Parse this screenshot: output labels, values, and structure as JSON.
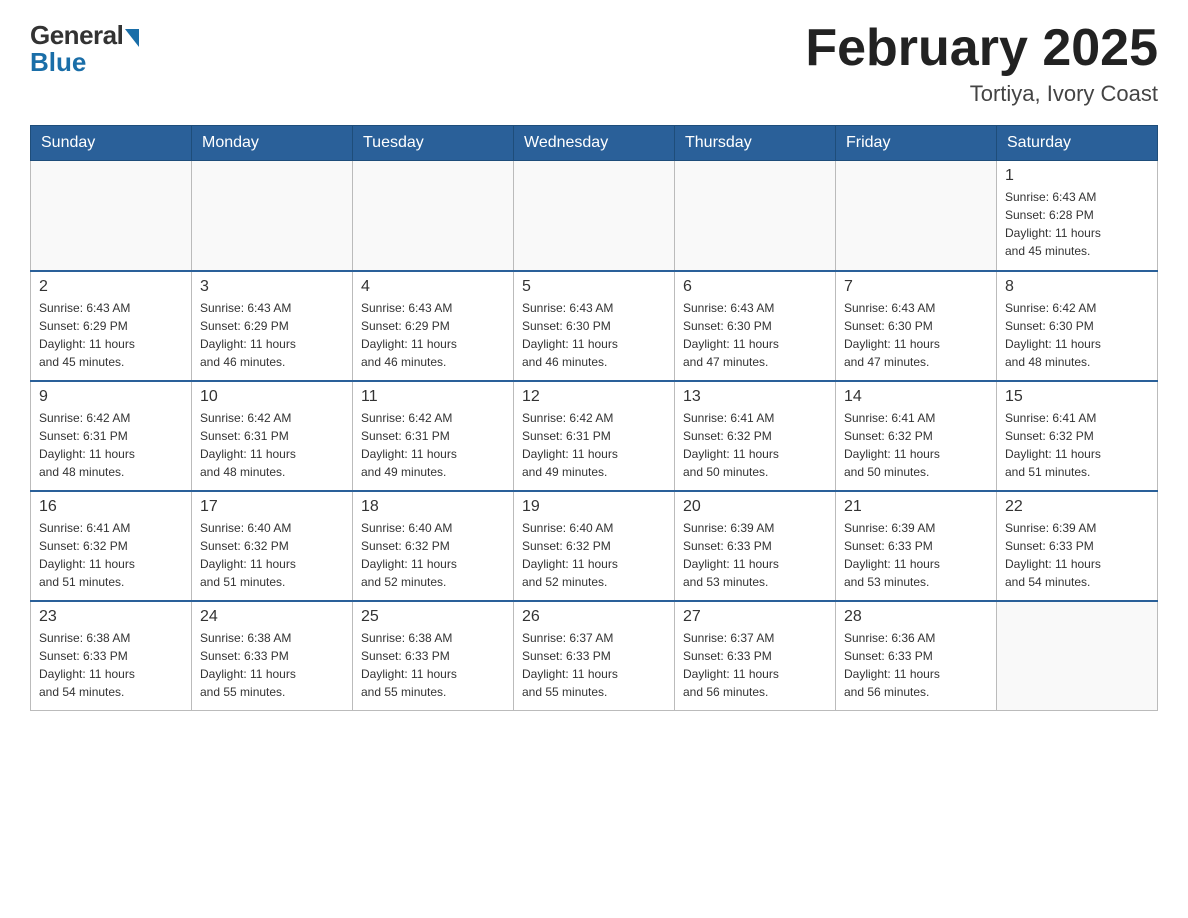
{
  "header": {
    "logo_general": "General",
    "logo_blue": "Blue",
    "month_title": "February 2025",
    "location": "Tortiya, Ivory Coast"
  },
  "weekdays": [
    "Sunday",
    "Monday",
    "Tuesday",
    "Wednesday",
    "Thursday",
    "Friday",
    "Saturday"
  ],
  "weeks": [
    [
      {
        "day": "",
        "info": ""
      },
      {
        "day": "",
        "info": ""
      },
      {
        "day": "",
        "info": ""
      },
      {
        "day": "",
        "info": ""
      },
      {
        "day": "",
        "info": ""
      },
      {
        "day": "",
        "info": ""
      },
      {
        "day": "1",
        "info": "Sunrise: 6:43 AM\nSunset: 6:28 PM\nDaylight: 11 hours\nand 45 minutes."
      }
    ],
    [
      {
        "day": "2",
        "info": "Sunrise: 6:43 AM\nSunset: 6:29 PM\nDaylight: 11 hours\nand 45 minutes."
      },
      {
        "day": "3",
        "info": "Sunrise: 6:43 AM\nSunset: 6:29 PM\nDaylight: 11 hours\nand 46 minutes."
      },
      {
        "day": "4",
        "info": "Sunrise: 6:43 AM\nSunset: 6:29 PM\nDaylight: 11 hours\nand 46 minutes."
      },
      {
        "day": "5",
        "info": "Sunrise: 6:43 AM\nSunset: 6:30 PM\nDaylight: 11 hours\nand 46 minutes."
      },
      {
        "day": "6",
        "info": "Sunrise: 6:43 AM\nSunset: 6:30 PM\nDaylight: 11 hours\nand 47 minutes."
      },
      {
        "day": "7",
        "info": "Sunrise: 6:43 AM\nSunset: 6:30 PM\nDaylight: 11 hours\nand 47 minutes."
      },
      {
        "day": "8",
        "info": "Sunrise: 6:42 AM\nSunset: 6:30 PM\nDaylight: 11 hours\nand 48 minutes."
      }
    ],
    [
      {
        "day": "9",
        "info": "Sunrise: 6:42 AM\nSunset: 6:31 PM\nDaylight: 11 hours\nand 48 minutes."
      },
      {
        "day": "10",
        "info": "Sunrise: 6:42 AM\nSunset: 6:31 PM\nDaylight: 11 hours\nand 48 minutes."
      },
      {
        "day": "11",
        "info": "Sunrise: 6:42 AM\nSunset: 6:31 PM\nDaylight: 11 hours\nand 49 minutes."
      },
      {
        "day": "12",
        "info": "Sunrise: 6:42 AM\nSunset: 6:31 PM\nDaylight: 11 hours\nand 49 minutes."
      },
      {
        "day": "13",
        "info": "Sunrise: 6:41 AM\nSunset: 6:32 PM\nDaylight: 11 hours\nand 50 minutes."
      },
      {
        "day": "14",
        "info": "Sunrise: 6:41 AM\nSunset: 6:32 PM\nDaylight: 11 hours\nand 50 minutes."
      },
      {
        "day": "15",
        "info": "Sunrise: 6:41 AM\nSunset: 6:32 PM\nDaylight: 11 hours\nand 51 minutes."
      }
    ],
    [
      {
        "day": "16",
        "info": "Sunrise: 6:41 AM\nSunset: 6:32 PM\nDaylight: 11 hours\nand 51 minutes."
      },
      {
        "day": "17",
        "info": "Sunrise: 6:40 AM\nSunset: 6:32 PM\nDaylight: 11 hours\nand 51 minutes."
      },
      {
        "day": "18",
        "info": "Sunrise: 6:40 AM\nSunset: 6:32 PM\nDaylight: 11 hours\nand 52 minutes."
      },
      {
        "day": "19",
        "info": "Sunrise: 6:40 AM\nSunset: 6:32 PM\nDaylight: 11 hours\nand 52 minutes."
      },
      {
        "day": "20",
        "info": "Sunrise: 6:39 AM\nSunset: 6:33 PM\nDaylight: 11 hours\nand 53 minutes."
      },
      {
        "day": "21",
        "info": "Sunrise: 6:39 AM\nSunset: 6:33 PM\nDaylight: 11 hours\nand 53 minutes."
      },
      {
        "day": "22",
        "info": "Sunrise: 6:39 AM\nSunset: 6:33 PM\nDaylight: 11 hours\nand 54 minutes."
      }
    ],
    [
      {
        "day": "23",
        "info": "Sunrise: 6:38 AM\nSunset: 6:33 PM\nDaylight: 11 hours\nand 54 minutes."
      },
      {
        "day": "24",
        "info": "Sunrise: 6:38 AM\nSunset: 6:33 PM\nDaylight: 11 hours\nand 55 minutes."
      },
      {
        "day": "25",
        "info": "Sunrise: 6:38 AM\nSunset: 6:33 PM\nDaylight: 11 hours\nand 55 minutes."
      },
      {
        "day": "26",
        "info": "Sunrise: 6:37 AM\nSunset: 6:33 PM\nDaylight: 11 hours\nand 55 minutes."
      },
      {
        "day": "27",
        "info": "Sunrise: 6:37 AM\nSunset: 6:33 PM\nDaylight: 11 hours\nand 56 minutes."
      },
      {
        "day": "28",
        "info": "Sunrise: 6:36 AM\nSunset: 6:33 PM\nDaylight: 11 hours\nand 56 minutes."
      },
      {
        "day": "",
        "info": ""
      }
    ]
  ]
}
